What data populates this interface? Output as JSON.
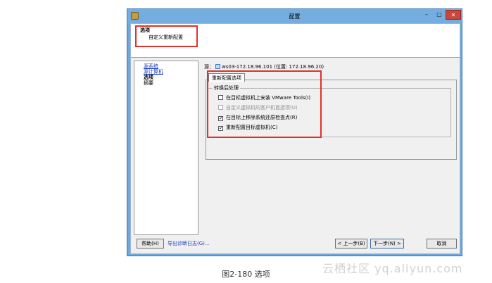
{
  "window": {
    "title": "配置",
    "min": "–",
    "max": "□",
    "close": "✕"
  },
  "header": {
    "title": "选项",
    "subtitle": "自定义重新配置"
  },
  "nav": {
    "items": [
      {
        "label": "源系统",
        "state": "link"
      },
      {
        "label": "源计算机",
        "state": "link"
      },
      {
        "label": "选项",
        "state": "current"
      },
      {
        "label": "摘要",
        "state": "plain"
      }
    ]
  },
  "source": {
    "prefix": "源：",
    "text": "ws03-172.18.96.101 (位置: 172.18.96.20)"
  },
  "tab": {
    "label": "重新配置选项"
  },
  "group": {
    "label": "转换后处理",
    "options": [
      {
        "label": "在目标虚拟机上安装 VMware Tools(I)",
        "checked": false,
        "enabled": true
      },
      {
        "label": "自定义虚拟机的客户机首选项(U)",
        "checked": false,
        "enabled": false
      },
      {
        "label": "在目标上移除系统还原检查点(R)",
        "checked": true,
        "enabled": true
      },
      {
        "label": "重新配置目标虚拟机(C)",
        "checked": true,
        "enabled": true
      }
    ]
  },
  "footer": {
    "help": "帮助(H)",
    "export_log": "导出诊断日志(G)...",
    "back": "< 上一步(B)",
    "next": "下一步(N) >",
    "cancel": "取消"
  },
  "caption": "图2-180 选项",
  "watermark": "云栖社区 yq.aliyun.com",
  "colors": {
    "highlight_box": "#e0312b",
    "title_bar": "#74aee0",
    "link": "#1a3fbf"
  }
}
